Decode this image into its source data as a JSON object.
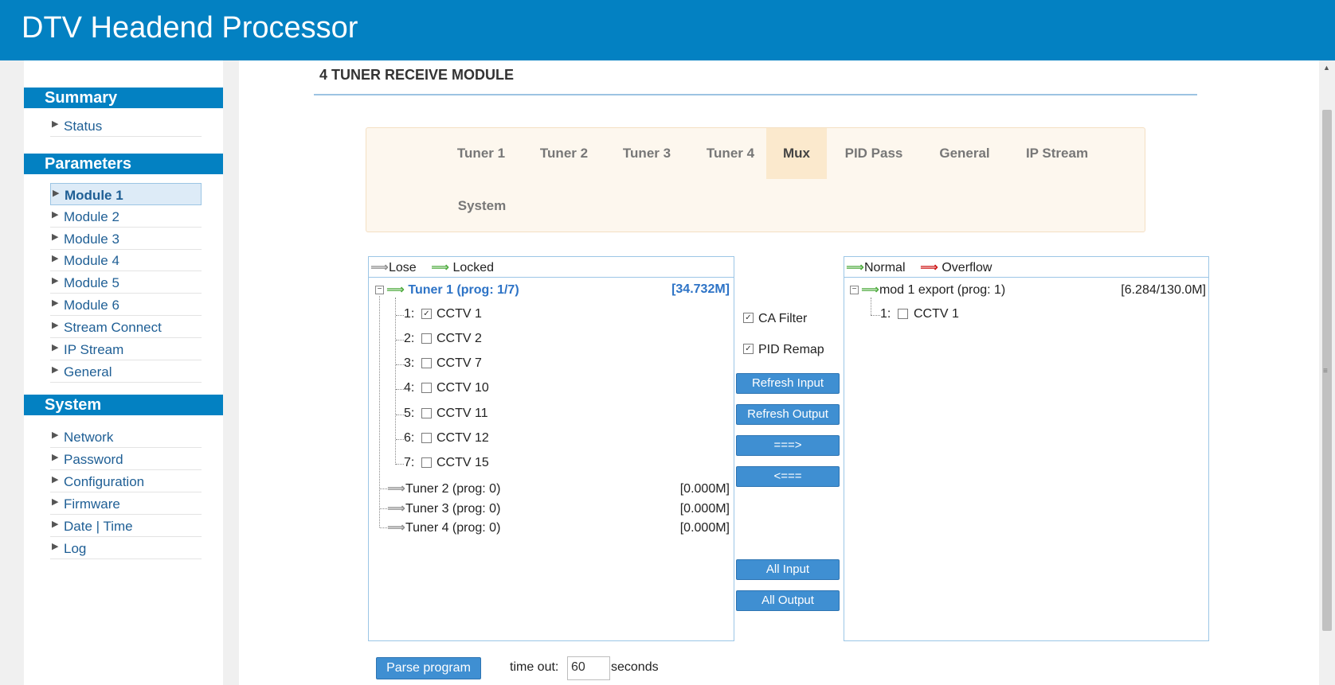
{
  "app": {
    "title": "DTV Headend Processor"
  },
  "sidebar": {
    "summary": {
      "heading": "Summary",
      "items": [
        "Status"
      ]
    },
    "parameters": {
      "heading": "Parameters",
      "active": "Module 1",
      "items": [
        "Module 1",
        "Module 2",
        "Module 3",
        "Module 4",
        "Module 5",
        "Module 6",
        "Stream Connect",
        "IP Stream",
        "General"
      ]
    },
    "system": {
      "heading": "System",
      "items": [
        "Network",
        "Password",
        "Configuration",
        "Firmware",
        "Date | Time",
        "Log"
      ]
    }
  },
  "page": {
    "title": "4 TUNER RECEIVE MODULE"
  },
  "tabs": {
    "active": "Mux",
    "items": [
      "Tuner 1",
      "Tuner 2",
      "Tuner 3",
      "Tuner 4",
      "Mux",
      "PID Pass",
      "General",
      "IP Stream",
      "System"
    ]
  },
  "input_panel": {
    "legend_lose": "Lose",
    "legend_locked": "Locked",
    "tuner1": {
      "label": "Tuner 1 (prog: 1/7)",
      "rate": "[34.732M]"
    },
    "programs": [
      {
        "index": "1:",
        "name": "CCTV 1",
        "checked": true
      },
      {
        "index": "2:",
        "name": "CCTV 2",
        "checked": false
      },
      {
        "index": "3:",
        "name": "CCTV 7",
        "checked": false
      },
      {
        "index": "4:",
        "name": "CCTV 10",
        "checked": false
      },
      {
        "index": "5:",
        "name": "CCTV 11",
        "checked": false
      },
      {
        "index": "6:",
        "name": "CCTV 12",
        "checked": false
      },
      {
        "index": "7:",
        "name": "CCTV 15",
        "checked": false
      }
    ],
    "other_tuners": [
      {
        "label": "Tuner 2 (prog: 0)",
        "rate": "[0.000M]"
      },
      {
        "label": "Tuner 3 (prog: 0)",
        "rate": "[0.000M]"
      },
      {
        "label": "Tuner 4 (prog: 0)",
        "rate": "[0.000M]"
      }
    ]
  },
  "controls": {
    "ca_filter": {
      "label": "CA Filter",
      "checked": true
    },
    "pid_remap": {
      "label": "PID Remap",
      "checked": true
    },
    "refresh_input": "Refresh Input",
    "refresh_output": "Refresh Output",
    "add": "===>",
    "remove": "<===",
    "all_input": "All Input",
    "all_output": "All Output"
  },
  "output_panel": {
    "legend_normal": "Normal",
    "legend_overflow": "Overflow",
    "mod": {
      "label": "mod 1 export (prog: 1)",
      "rate": "[6.284/130.0M]"
    },
    "programs": [
      {
        "index": "1:",
        "name": "CCTV 1",
        "checked": false
      }
    ]
  },
  "footer": {
    "parse_button": "Parse program",
    "timeout_label": "time out:",
    "timeout_value": "60",
    "seconds_label": "seconds"
  },
  "colors": {
    "header_blue": "#0381c2",
    "button_blue": "#3f8fd2",
    "locked_green": "#4caa3c",
    "lose_gray": "#8a8a8a",
    "overflow_red": "#cc1111"
  },
  "icons": {
    "lose": "gray-right-arrow-icon",
    "locked": "green-right-arrow-icon",
    "overflow": "red-right-arrow-icon"
  }
}
